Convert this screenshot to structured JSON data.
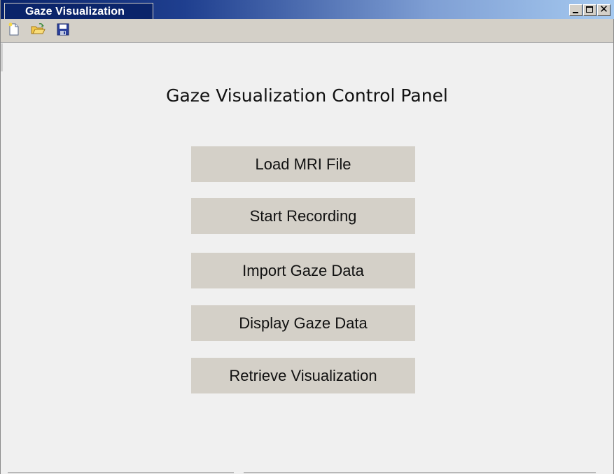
{
  "window": {
    "title": "Gaze Visualization",
    "controls": [
      "minimize",
      "maximize",
      "close"
    ]
  },
  "toolbar": {
    "items": [
      {
        "icon": "new-file-icon"
      },
      {
        "icon": "open-folder-icon"
      },
      {
        "icon": "save-icon"
      }
    ]
  },
  "panel": {
    "title": "Gaze Visualization Control Panel",
    "buttons": [
      {
        "label": "Load MRI File"
      },
      {
        "label": "Start Recording"
      },
      {
        "label": "Import Gaze Data"
      },
      {
        "label": "Display Gaze Data"
      },
      {
        "label": "Retrieve Visualization"
      }
    ]
  },
  "colors": {
    "titlebar_start": "#0a246a",
    "titlebar_end": "#a6caf0",
    "button_face": "#d4d0c8",
    "background": "#f0f0f0"
  }
}
